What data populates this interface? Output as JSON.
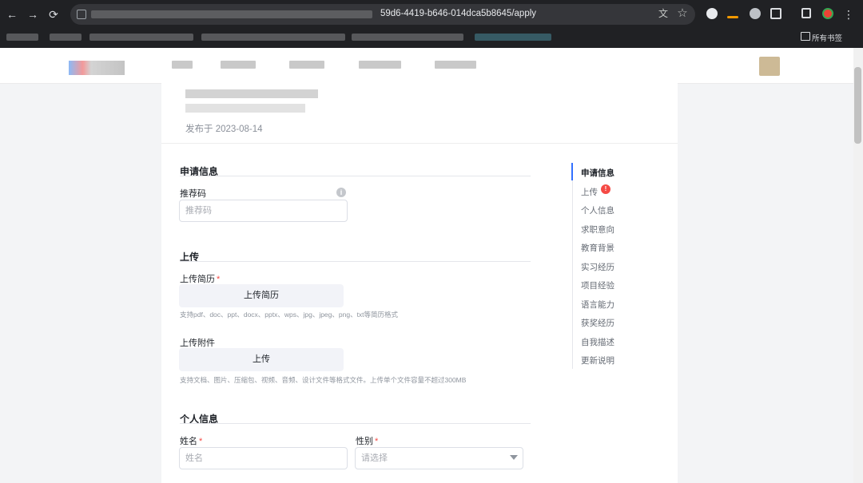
{
  "browser": {
    "url_suffix": "59d6-4419-b646-014dca5b8645/apply",
    "bookmarks_folder_label": "所有书签",
    "back_icon": "←",
    "forward_icon": "→",
    "reload_icon": "⟳",
    "translate_icon": "文",
    "star_icon": "☆",
    "menu_icon": "⋮"
  },
  "job": {
    "publish_date": "发布于 2023-08-14"
  },
  "form": {
    "application_info": {
      "title": "申请信息",
      "referral_label": "推荐码",
      "referral_placeholder": "推荐码",
      "info_icon": "i"
    },
    "upload": {
      "title": "上传",
      "resume_label": "上传简历",
      "resume_required": "*",
      "resume_button": "上传简历",
      "resume_hint": "支持pdf、doc、ppt、docx、pptx、wps、jpg、jpeg、png、txt等简历格式",
      "attachment_label": "上传附件",
      "attachment_button": "上传",
      "attachment_hint": "支持文档、图片、压缩包、视频、音频、设计文件等格式文件。上传单个文件容量不超过300MB"
    },
    "personal_info": {
      "title": "个人信息",
      "name_label": "姓名",
      "name_required": "*",
      "name_placeholder": "姓名",
      "gender_label": "性别",
      "gender_required": "*",
      "gender_placeholder": "请选择"
    }
  },
  "side_nav": {
    "items": [
      "申请信息",
      "上传",
      "个人信息",
      "求职意向",
      "教育背景",
      "实习经历",
      "项目经验",
      "语言能力",
      "获奖经历",
      "自我描述",
      "更新说明"
    ],
    "active_index": 0,
    "alert_badge": "!"
  },
  "colors": {
    "accent": "#3370ff",
    "required": "#f54a45",
    "alert": "#f54a45"
  }
}
